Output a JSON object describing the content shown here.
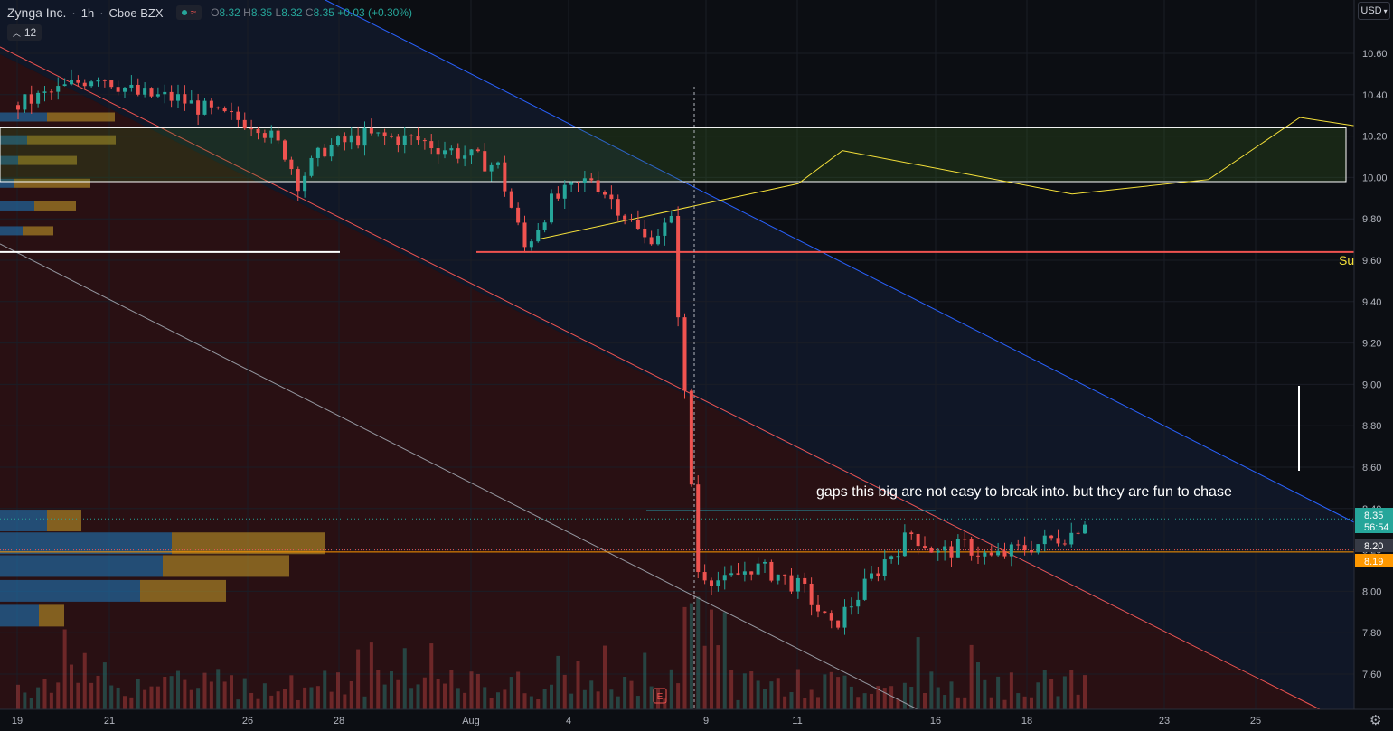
{
  "header": {
    "title": "Zynga Inc.",
    "interval": "1h",
    "exchange": "Cboe BZX",
    "ohlc": {
      "o_label": "O",
      "o": "8.32",
      "h_label": "H",
      "h": "8.35",
      "l_label": "L",
      "l": "8.32",
      "c_label": "C",
      "c": "8.35",
      "change": "+0.03 (+0.30%)"
    },
    "indicator_count": "12",
    "currency": "USD"
  },
  "annotation": "gaps this big are not easy to break into.  but they are fun to chase",
  "support_label": "Su",
  "colors": {
    "up": "#26a69a",
    "down": "#ef5350",
    "background": "#0c0e13",
    "accent_yellow": "#f7e23a",
    "blue_line": "#2962ff"
  },
  "chart_data": {
    "type": "candlestick",
    "symbol": "Zynga Inc.",
    "interval": "1h",
    "y_ticks": [
      "10.60",
      "10.40",
      "10.20",
      "10.00",
      "9.80",
      "9.60",
      "9.40",
      "9.20",
      "9.00",
      "8.80",
      "8.60",
      "8.40",
      "8.20",
      "8.00",
      "7.80",
      "7.60"
    ],
    "x_ticks": [
      "19",
      "21",
      "26",
      "28",
      "Aug",
      "4",
      "9",
      "11",
      "16",
      "18",
      "23",
      "25"
    ],
    "ylim": [
      7.48,
      10.78
    ],
    "price_labels": [
      {
        "value": "8.35",
        "sub": "56:54",
        "color": "#26a69a"
      },
      {
        "value": "8.20",
        "color": "#363a45"
      },
      {
        "value": "8.19",
        "color": "#ff9800"
      }
    ],
    "key_levels": {
      "resistance_zone": [
        9.98,
        10.24
      ],
      "red_support": 9.64,
      "white_level": 9.64,
      "orange_level": 8.19,
      "gap_top": 8.39,
      "last": 8.35
    },
    "yellow_projection": [
      [
        9.7,
        0
      ],
      [
        9.97,
        1
      ],
      [
        10.13,
        2
      ],
      [
        9.92,
        3
      ],
      [
        9.99,
        4
      ],
      [
        10.29,
        5
      ],
      [
        10.25,
        6
      ]
    ],
    "price_path": [
      [
        0,
        10.35
      ],
      [
        6,
        10.42
      ],
      [
        12,
        10.5
      ],
      [
        18,
        10.4
      ],
      [
        24,
        10.38
      ],
      [
        30,
        10.3
      ],
      [
        36,
        10.26
      ],
      [
        40,
        10.12
      ],
      [
        42,
        9.98
      ],
      [
        46,
        10.14
      ],
      [
        52,
        10.2
      ],
      [
        60,
        10.18
      ],
      [
        66,
        10.12
      ],
      [
        72,
        10.05
      ],
      [
        76,
        9.66
      ],
      [
        80,
        9.88
      ],
      [
        86,
        10.0
      ],
      [
        90,
        9.86
      ],
      [
        94,
        9.7
      ],
      [
        98,
        9.78
      ],
      [
        102,
        8.1
      ],
      [
        106,
        8.04
      ],
      [
        110,
        8.12
      ],
      [
        114,
        8.08
      ],
      [
        118,
        8.0
      ],
      [
        122,
        7.82
      ],
      [
        126,
        7.98
      ],
      [
        130,
        8.15
      ],
      [
        134,
        8.28
      ],
      [
        138,
        8.18
      ],
      [
        142,
        8.22
      ],
      [
        146,
        8.16
      ],
      [
        150,
        8.2
      ],
      [
        154,
        8.24
      ],
      [
        158,
        8.28
      ],
      [
        160,
        8.35
      ]
    ],
    "edge_volume_profile_lower": [
      {
        "price": 8.34,
        "blue": 52,
        "gold": 38
      },
      {
        "price": 8.23,
        "blue": 190,
        "gold": 170
      },
      {
        "price": 8.12,
        "blue": 180,
        "gold": 140
      },
      {
        "price": 8.0,
        "blue": 155,
        "gold": 95
      },
      {
        "price": 7.88,
        "blue": 43,
        "gold": 28
      }
    ],
    "edge_volume_profile_upper": [
      {
        "price": 10.29,
        "blue": 52,
        "gold": 75
      },
      {
        "price": 10.18,
        "blue": 30,
        "gold": 98
      },
      {
        "price": 10.08,
        "blue": 20,
        "gold": 65
      },
      {
        "price": 9.97,
        "blue": 15,
        "gold": 85
      },
      {
        "price": 9.86,
        "blue": 38,
        "gold": 46
      },
      {
        "price": 9.74,
        "blue": 25,
        "gold": 34
      }
    ]
  }
}
